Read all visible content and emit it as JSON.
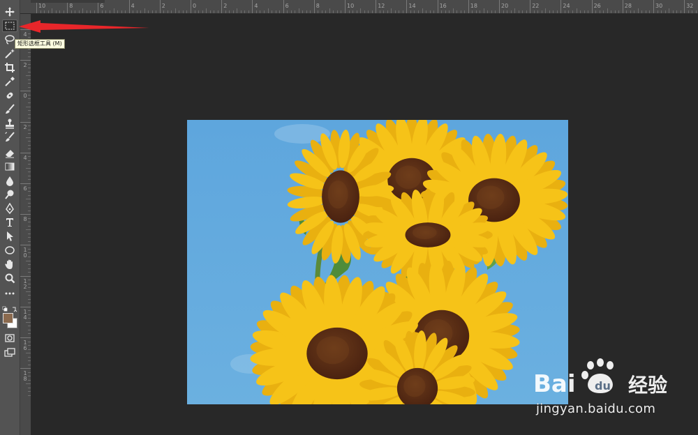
{
  "tooltip": {
    "text": "矩形选框工具 (M)"
  },
  "toolbar": {
    "tools": [
      "move-tool",
      "rectangular-marquee-tool",
      "lasso-tool",
      "magic-wand-tool",
      "crop-tool",
      "eyedropper-tool",
      "healing-brush-tool",
      "brush-tool",
      "clone-stamp-tool",
      "history-brush-tool",
      "eraser-tool",
      "gradient-tool",
      "blur-tool",
      "dodge-tool",
      "pen-tool",
      "type-tool",
      "path-selection-tool",
      "ellipse-tool",
      "hand-tool",
      "zoom-tool",
      "more-tools"
    ],
    "active_tool": "rectangular-marquee-tool",
    "foreground_color": "#8b6a4e",
    "background_color": "#ffffff"
  },
  "rulers": {
    "horizontal_labels": [
      "10",
      "8",
      "6",
      "4",
      "2",
      "0",
      "2",
      "4",
      "6",
      "8",
      "10",
      "12",
      "14",
      "16",
      "18",
      "20",
      "22",
      "24",
      "26",
      "28",
      "30",
      "32"
    ],
    "vertical_labels": [
      "4",
      "2",
      "0",
      "2",
      "4",
      "6",
      "8",
      "1 0",
      "1 2",
      "1 4",
      "1 6",
      "1 8"
    ]
  },
  "document": {
    "sky_color": "#6bb0e0",
    "petal_color": "#f6c318",
    "center_color": "#4a2210"
  },
  "annotation": {
    "arrow_color": "#e8262a"
  },
  "watermark": {
    "site_text": "jingyan.baidu.com",
    "brand_text": "Bai  经验"
  }
}
